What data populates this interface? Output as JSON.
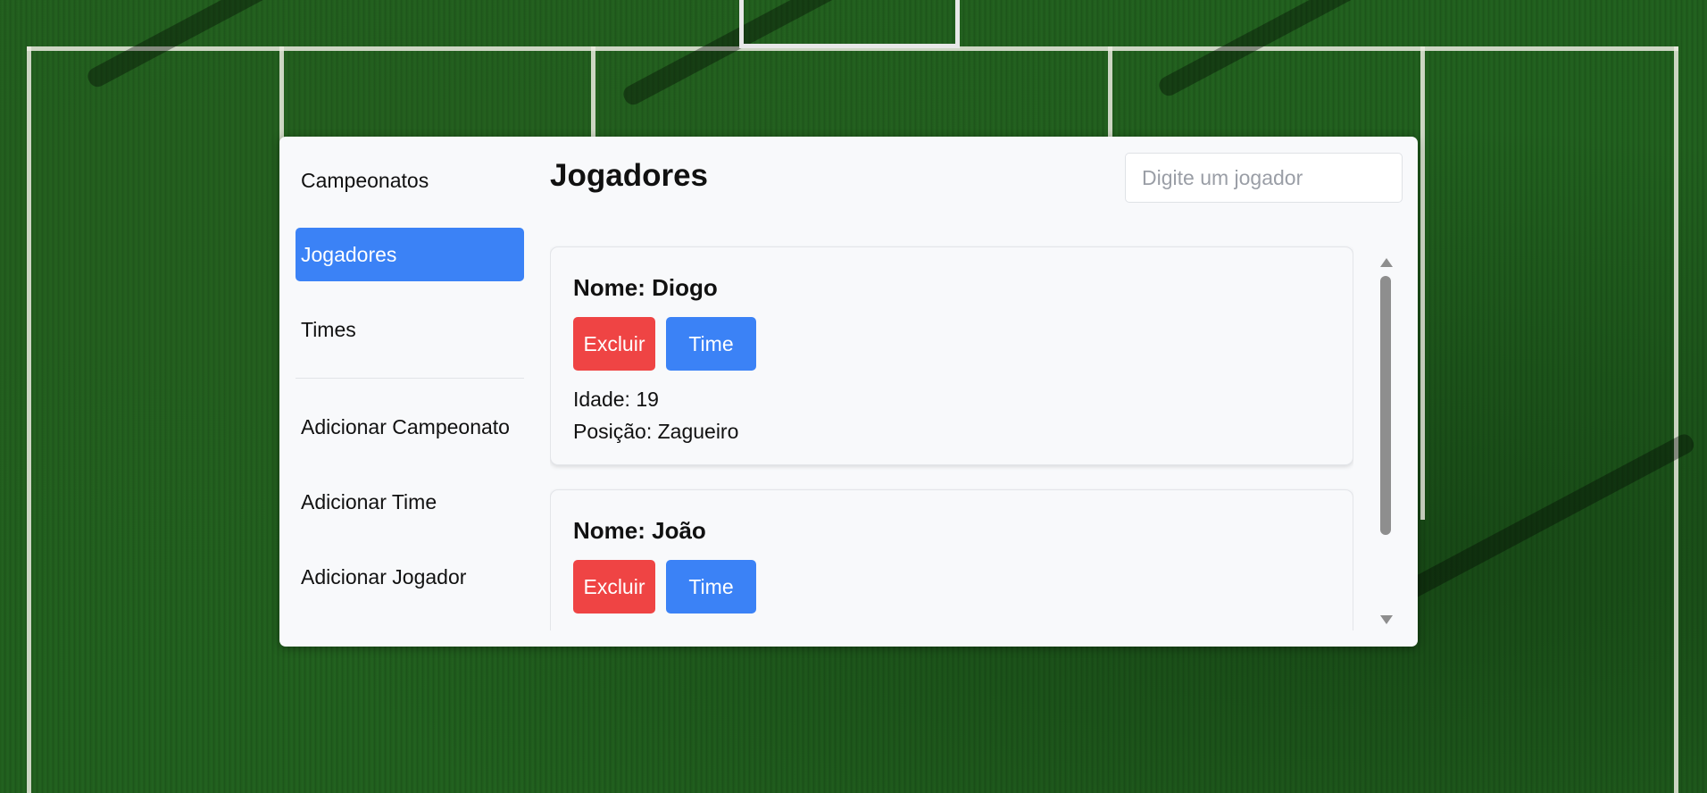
{
  "sidebar": {
    "items": [
      {
        "label": "Campeonatos"
      },
      {
        "label": "Jogadores"
      },
      {
        "label": "Times"
      },
      {
        "label": "Adicionar Campeonato"
      },
      {
        "label": "Adicionar Time"
      },
      {
        "label": "Adicionar Jogador"
      }
    ],
    "active_item": "Jogadores"
  },
  "main": {
    "title": "Jogadores",
    "search": {
      "placeholder": "Digite um jogador",
      "value": ""
    }
  },
  "players": [
    {
      "name": "Nome: Diogo",
      "delete_label": "Excluir",
      "team_label": "Time",
      "age": "Idade: 19",
      "position": "Posição: Zagueiro"
    },
    {
      "name": "Nome: João",
      "delete_label": "Excluir",
      "team_label": "Time"
    }
  ],
  "colors": {
    "accent": "#3b82f6",
    "danger": "#ef4444",
    "panel_bg": "#f8f9fb",
    "field_green": "#1f5a1c"
  },
  "icons": [
    "scroll-up-arrow-icon",
    "scroll-down-arrow-icon"
  ]
}
